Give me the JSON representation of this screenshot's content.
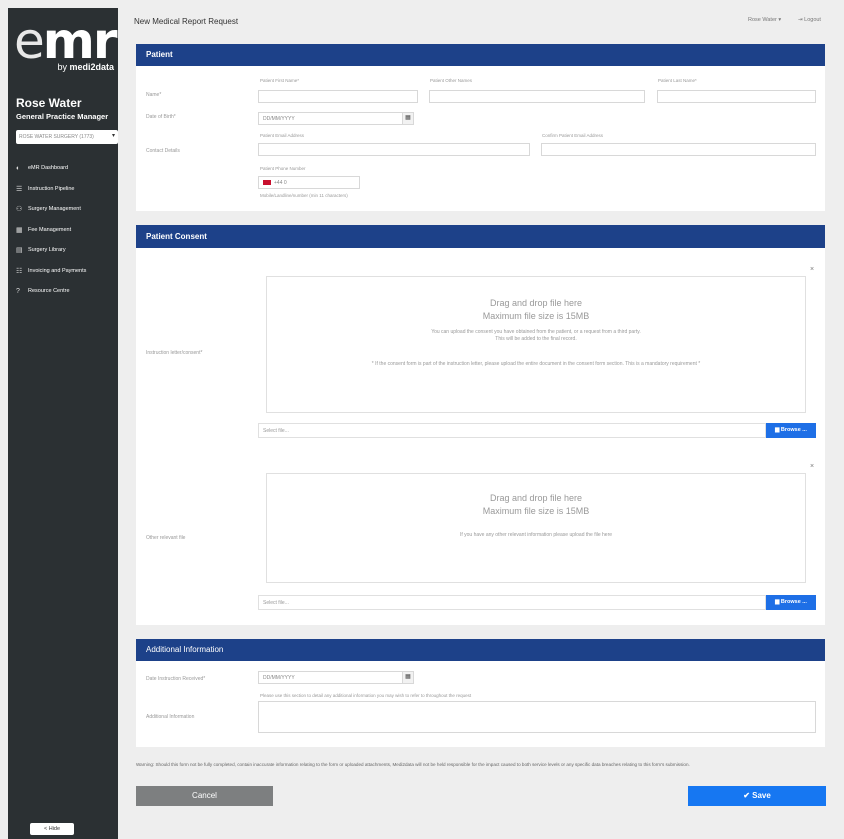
{
  "sidebar": {
    "logo_main": "mr",
    "logo_e": "e",
    "logo_sub_prefix": "by ",
    "logo_sub_brand": "medi2data",
    "practice_name": "Rose Water",
    "practice_role": "General Practice Manager",
    "surgery_select": "ROSE WATER SURGERY (1773)",
    "nav": [
      {
        "icon": "dashboard-icon",
        "glyph": "◐",
        "label": "eMR Dashboard"
      },
      {
        "icon": "list-icon",
        "glyph": "☰",
        "label": "Instruction Pipeline"
      },
      {
        "icon": "users-icon",
        "glyph": "⚇",
        "label": "Surgery Management"
      },
      {
        "icon": "table-icon",
        "glyph": "▦",
        "label": "Fee Management"
      },
      {
        "icon": "book-icon",
        "glyph": "▤",
        "label": "Surgery Library"
      },
      {
        "icon": "invoice-icon",
        "glyph": "☷",
        "label": "Invoicing and Payments"
      },
      {
        "icon": "help-icon",
        "glyph": "?",
        "label": "Resource Centre"
      }
    ],
    "hide_label": "< Hide"
  },
  "header": {
    "title": "New Medical Report Request",
    "user_menu": "Rose Water ▾",
    "logout": "⇥ Logout"
  },
  "patient": {
    "section_title": "Patient",
    "name_label": "Name*",
    "first_name_label": "Patient First Name*",
    "other_names_label": "Patient Other Names",
    "last_name_label": "Patient Last Name*",
    "dob_label": "Date of Birth*",
    "dob_placeholder": "DD/MM/YYYY",
    "contact_label": "Contact Details",
    "email_label": "Patient Email Address",
    "confirm_email_label": "Confirm Patient Email Address",
    "phone_label": "Patient Phone Number",
    "phone_value": "+44 0",
    "phone_hint": "Mobile/Landline/number (min 11 characters)"
  },
  "consent": {
    "section_title": "Patient Consent",
    "instruction_label": "Instruction letter/consent*",
    "drop_title": "Drag and drop file here",
    "drop_max": "Maximum file size is 15MB",
    "drop_note1": "You can upload the consent you have obtained from the patient, or a request from a third party.",
    "drop_note2": "This will be added to the final record.",
    "drop_note3": "* If the consent form is part of the instruction letter, please upload the entire document in the consent form section. This is a mandatory requirement *",
    "select_file": "Select file...",
    "browse": "▆ Browse ...",
    "other_label": "Other relevant file",
    "drop_title2": "Drag and drop file here",
    "drop_max2": "Maximum file size is 15MB",
    "drop_note4": "If you have any other relevant information please upload the file here",
    "select_file2": "Select file...",
    "browse2": "▆ Browse ..."
  },
  "additional": {
    "section_title": "Additional Information",
    "date_label": "Date Instruction Received*",
    "date_placeholder": "DD/MM/YYYY",
    "info_label": "Additional Information",
    "info_hint": "Please use this section to detail any additional information you may wish to refer to throughout the request"
  },
  "footer": {
    "warning": "Warning: Should this form not be fully completed, contain inaccurate information relating to the form or uploaded attachments, Medi2data will not be held responsible for the impact caused to both service levels or any specific data breaches relating to this form's submission.",
    "cancel": "Cancel",
    "save": "✔ Save"
  },
  "colors": {
    "sidebar": "#2b3033",
    "section_bar": "#1d4189",
    "primary": "#1677f2",
    "cancel": "#7d7f80"
  }
}
